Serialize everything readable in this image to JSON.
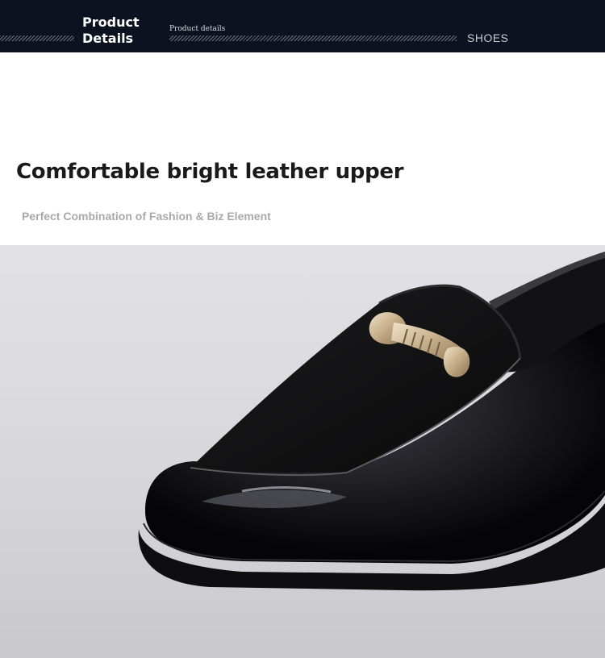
{
  "header": {
    "title_line1": "Product",
    "title_line2": "Details",
    "subtitle": "Product details",
    "category": "SHOES",
    "separator": "·"
  },
  "section": {
    "heading": "Comfortable bright leather upper",
    "subheading": "Perfect Combination of Fashion & Biz Element"
  },
  "photo": {
    "subject": "black-patent-loafer-with-suede-vamp-and-gold-buckle",
    "colors": {
      "background": "#d9d9dd",
      "leather": "#0b0b0d",
      "suede": "#111112",
      "buckle": "#cdb89a"
    }
  }
}
